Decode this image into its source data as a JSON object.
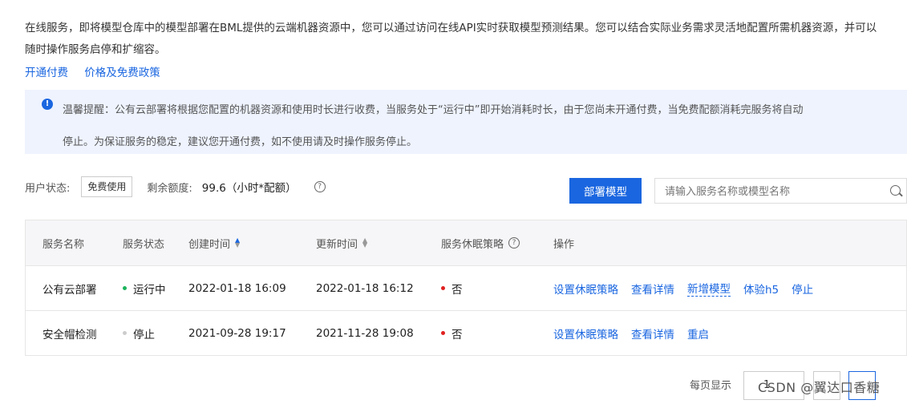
{
  "description": {
    "line1": "在线服务，即将模型仓库中的模型部署在BML提供的云端机器资源中，您可以通过访问在线API实时获取模型预测结果。您可以结合实际业务需求灵活地配置所需机器资源，并可以",
    "line2": "随时操作服务启停和扩缩容。"
  },
  "links": {
    "activate": "开通付费",
    "pricing": "价格及免费政策"
  },
  "notice": {
    "icon": "exclamation-icon",
    "line1": "温馨提醒：公有云部署将根据您配置的机器资源和使用时长进行收费，当服务处于“运行中”即开始消耗时长，由于您尚未开通付费，当免费配额消耗完服务将自动",
    "line2": "停止。为保证服务的稳定，建议您开通付费，如不使用请及时操作服务停止。"
  },
  "user_status": {
    "label": "用户状态:",
    "badge": "免费使用",
    "quota_label": "剩余额度:",
    "quota_value": "99.6（小时*配额）",
    "help": "?"
  },
  "toolbar": {
    "deploy_label": "部署模型",
    "search_placeholder": "请输入服务名称或模型名称"
  },
  "table": {
    "headers": {
      "name": "服务名称",
      "status": "服务状态",
      "created": "创建时间",
      "updated": "更新时间",
      "sleep": "服务休眠策略",
      "actions": "操作",
      "sleep_help": "?"
    },
    "rows": [
      {
        "name": "公有云部署",
        "status": "运行中",
        "status_color": "#1bb35c",
        "created": "2022-01-18 16:09",
        "updated": "2022-01-18 16:12",
        "sleep": "否",
        "sleep_color": "#e02020",
        "actions": [
          "设置休眠策略",
          "查看详情",
          "新增模型",
          "体验h5",
          "停止"
        ]
      },
      {
        "name": "安全帽检测",
        "status": "停止",
        "status_color": "#cccccc",
        "created": "2021-09-28 19:17",
        "updated": "2021-11-28 19:08",
        "sleep": "否",
        "sleep_color": "#e02020",
        "actions": [
          "设置休眠策略",
          "查看详情",
          "重启"
        ]
      }
    ]
  },
  "pagination": {
    "per_page_label": "每页显示",
    "page_size": "1"
  },
  "watermark": "CSDN @翼达口香糖",
  "colors": {
    "accent": "#1a66e0",
    "notice_bg": "#eef3fe",
    "header_bg": "#f6f6f8"
  }
}
